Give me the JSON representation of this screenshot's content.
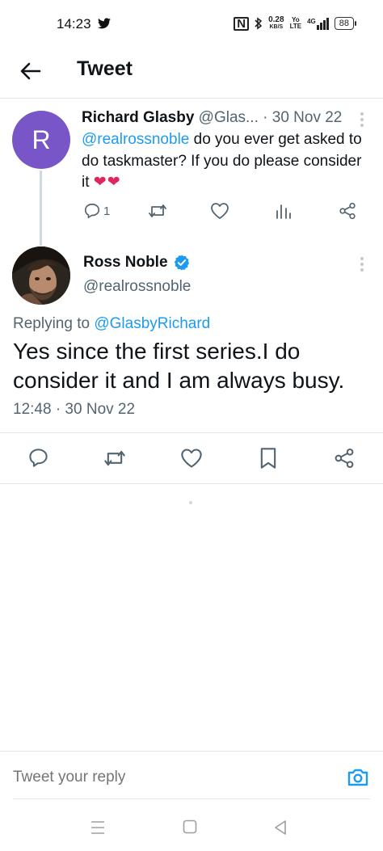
{
  "status_bar": {
    "time": "14:23",
    "nfc": "N",
    "speed_value": "0.28",
    "speed_unit": "KB/S",
    "volte_top": "Yo",
    "volte_bottom": "LTE",
    "network": "4G",
    "battery": "88"
  },
  "header": {
    "title": "Tweet"
  },
  "parent_tweet": {
    "author_name": "Richard Glasby",
    "handle_truncated": "@Glas...",
    "date": "· 30 Nov 22",
    "mention": "@realrossnoble",
    "text": " do you ever get asked to do taskmaster? If you do please consider it",
    "emoji": "❤❤",
    "avatar_letter": "R",
    "reply_count": "1"
  },
  "main_tweet": {
    "author_name": "Ross Noble",
    "handle": "@realrossnoble",
    "replying_prefix": "Replying to",
    "replying_to": "@GlasbyRichard",
    "text": "Yes since the first series.I do consider it and I am always busy.",
    "timestamp": "12:48 · 30 Nov 22"
  },
  "reply_bar": {
    "placeholder": "Tweet your reply"
  },
  "colors": {
    "accent": "#1d9bf0",
    "avatar_bg": "#7856c8",
    "heart": "#e0245e",
    "secondary_text": "#536471"
  }
}
